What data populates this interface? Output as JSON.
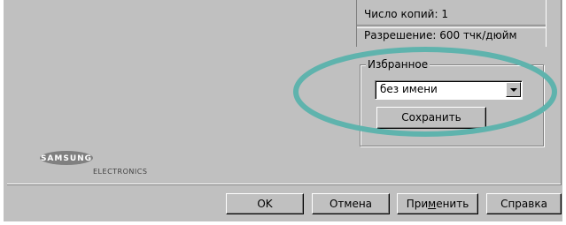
{
  "info": {
    "copies": "Число копий: 1",
    "resolution": "Разрешение: 600 тчк/дюйм"
  },
  "favorites": {
    "title": "Избранное",
    "selected": "без имени",
    "save_label": "Сохранить"
  },
  "logo": {
    "brand": "SAMSUNG",
    "sub": "ELECTRONICS"
  },
  "footer": {
    "ok_label": "OK",
    "cancel_label": "Отмена",
    "apply_label_pre": "При",
    "apply_label_mnemonic": "м",
    "apply_label_post": "енить",
    "help_label": "Справка"
  },
  "colors": {
    "face": "#c0c0c0",
    "highlight_ellipse": "#5fb3ad"
  }
}
